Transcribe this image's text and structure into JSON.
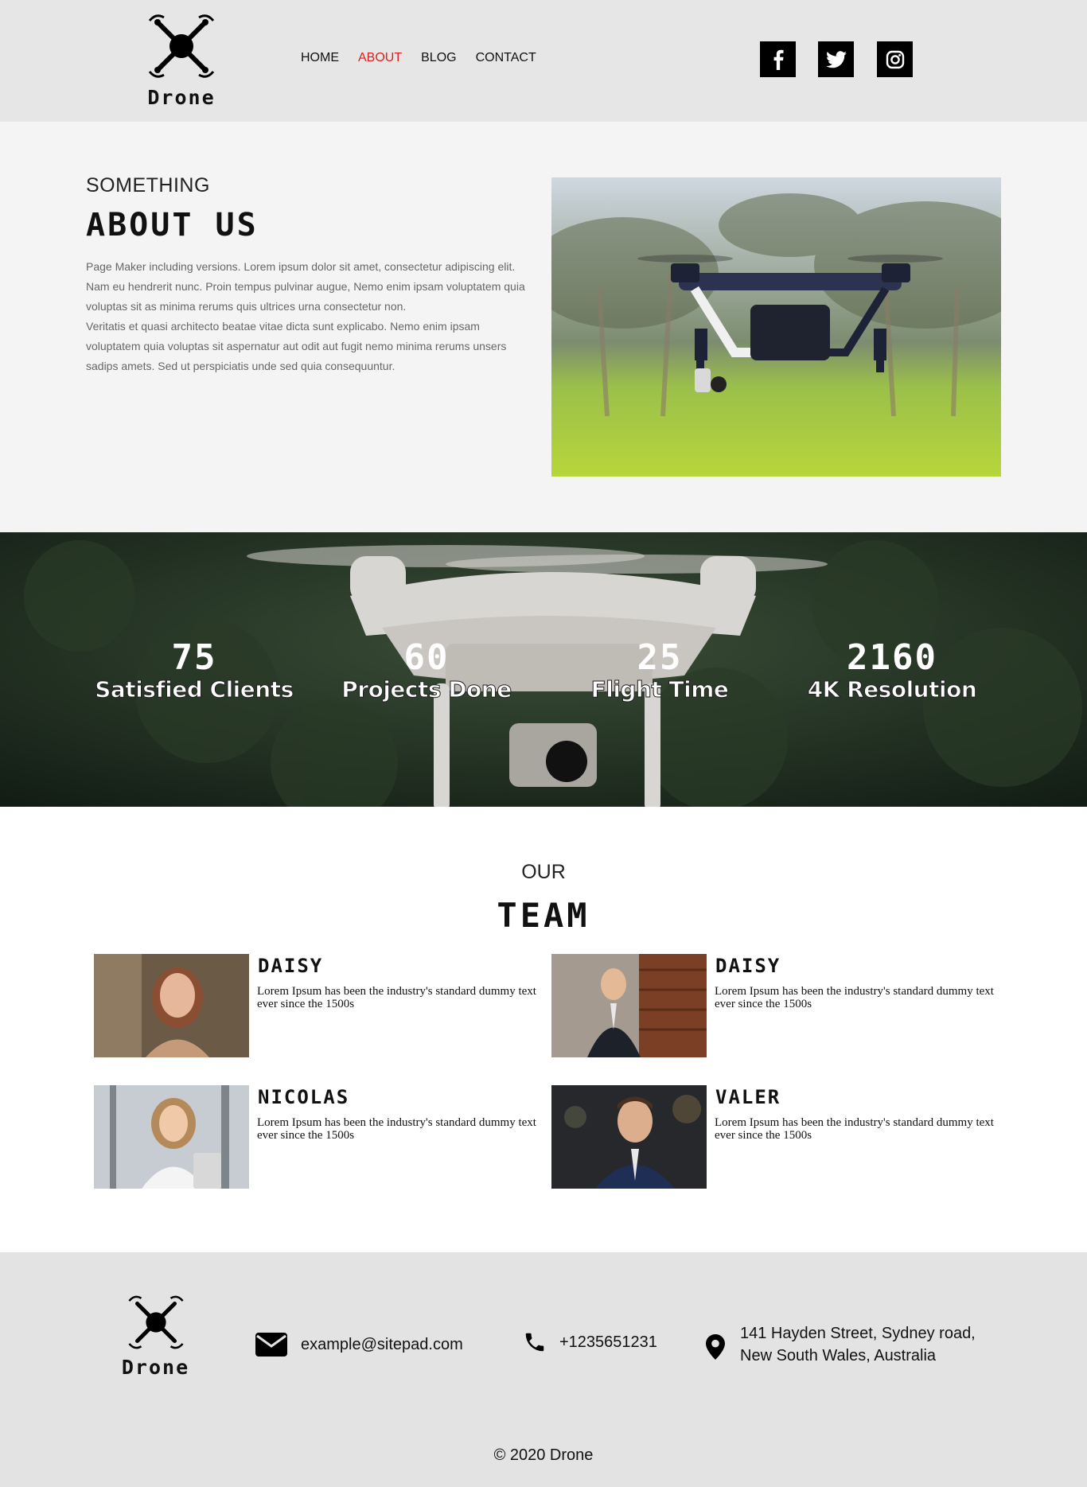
{
  "header": {
    "logo_text": "Drone",
    "nav": [
      {
        "label": "HOME",
        "active": false
      },
      {
        "label": "ABOUT",
        "active": true
      },
      {
        "label": "BLOG",
        "active": false
      },
      {
        "label": "CONTACT",
        "active": false
      }
    ],
    "social": [
      "facebook-icon",
      "twitter-icon",
      "instagram-icon"
    ],
    "accent_color": "#e02020"
  },
  "about": {
    "kicker": "SOMETHING",
    "title": "ABOUT US",
    "paragraph1": "Page Maker including versions. Lorem ipsum dolor sit amet, consectetur adipiscing elit. Nam eu hendrerit nunc. Proin tempus pulvinar augue, Nemo enim ipsam voluptatem quia voluptas sit as minima rerums quis ultrices urna consectetur non.",
    "paragraph2": "Veritatis et quasi architecto beatae vitae dicta sunt explicabo. Nemo enim ipsam voluptatem quia voluptas sit aspernatur aut odit aut fugit nemo minima rerums unsers sadips amets. Sed ut perspiciatis unde sed quia consequuntur."
  },
  "stats": [
    {
      "value": "75",
      "label": "Satisfied Clients"
    },
    {
      "value": "60",
      "label": "Projects Done"
    },
    {
      "value": "25",
      "label": "Flight Time"
    },
    {
      "value": "2160",
      "label": "4K Resolution"
    }
  ],
  "team": {
    "kicker": "OUR",
    "title": "TEAM",
    "members": [
      {
        "name": "DAISY",
        "bio": "Lorem Ipsum has been the industry's standard dummy text ever since the 1500s"
      },
      {
        "name": "DAISY",
        "bio": "Lorem Ipsum has been the industry's standard dummy text ever since the 1500s"
      },
      {
        "name": "NICOLAS",
        "bio": "Lorem Ipsum has been the industry's standard dummy text ever since the 1500s"
      },
      {
        "name": "VALER",
        "bio": "Lorem Ipsum has been the industry's standard dummy text ever since the 1500s"
      }
    ]
  },
  "footer": {
    "logo_text": "Drone",
    "email": "example@sitepad.com",
    "phone": "+1235651231",
    "address": "141 Hayden Street, Sydney road, New South Wales, Australia",
    "copyright": "© 2020 Drone"
  }
}
